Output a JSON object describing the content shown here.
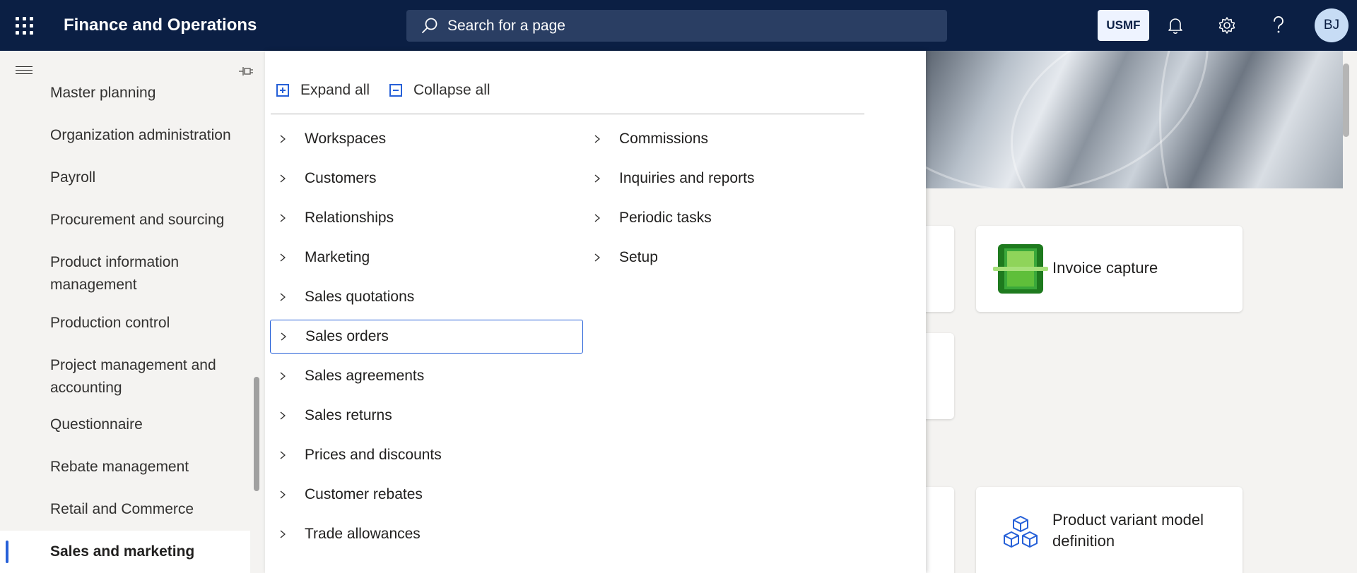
{
  "header": {
    "app_title": "Finance and Operations",
    "search_placeholder": "Search for a page",
    "company": "USMF",
    "user_initials": "BJ"
  },
  "nav": {
    "items": [
      "Master planning",
      "Organization administration",
      "Payroll",
      "Procurement and sourcing",
      "Product information management",
      "Production control",
      "Project management and accounting",
      "Questionnaire",
      "Rebate management",
      "Retail and Commerce",
      "Sales and marketing"
    ],
    "active": "Sales and marketing"
  },
  "flyout": {
    "expand_all": "Expand all",
    "collapse_all": "Collapse all",
    "column1": [
      "Workspaces",
      "Customers",
      "Relationships",
      "Marketing",
      "Sales quotations",
      "Sales orders",
      "Sales agreements",
      "Sales returns",
      "Prices and discounts",
      "Customer rebates",
      "Trade allowances"
    ],
    "column2": [
      "Commissions",
      "Inquiries and reports",
      "Periodic tasks",
      "Setup"
    ],
    "focused_item": "Sales orders"
  },
  "tiles": {
    "invoice_capture": "Invoice capture",
    "product_variant": "Product variant model definition"
  },
  "colors": {
    "topbar": "#0b1f44",
    "accent": "#2660d8"
  }
}
